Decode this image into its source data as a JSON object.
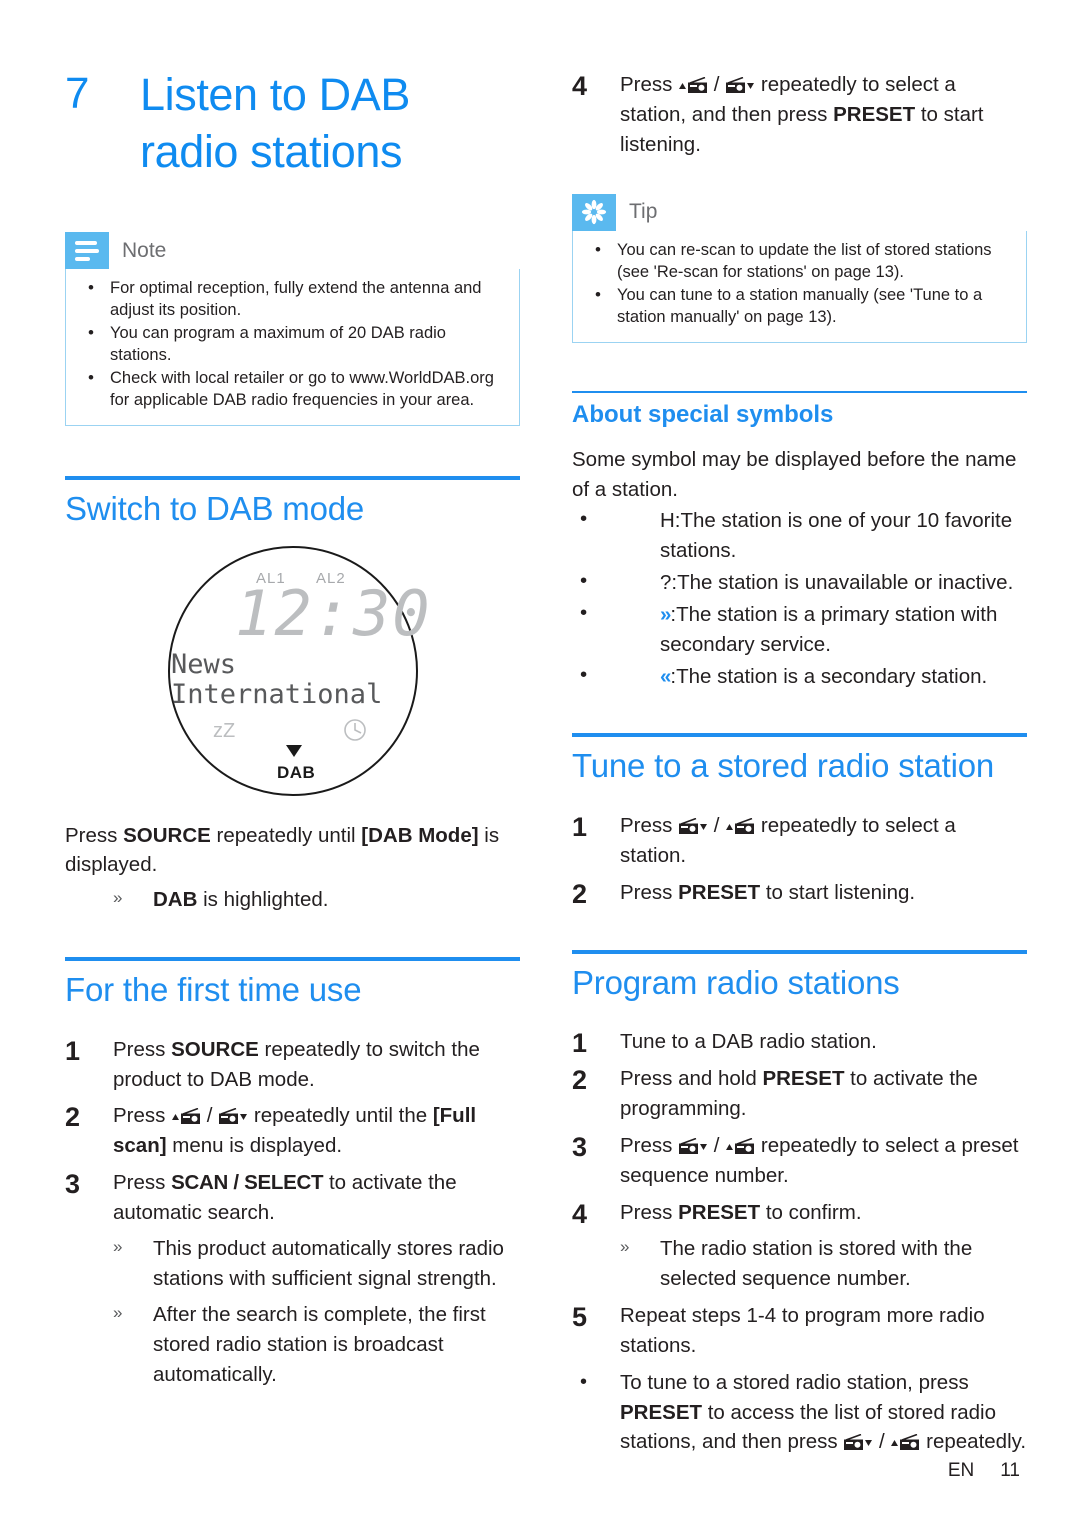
{
  "chapter": {
    "number": "7",
    "title_line1": "Listen to DAB",
    "title_line2": "radio stations"
  },
  "note": {
    "label": "Note",
    "icon": "note-lines-icon",
    "items": [
      "For optimal reception, fully extend the antenna and adjust its position.",
      "You can program a maximum of 20 DAB radio stations.",
      "Check with local retailer or go to www.WorldDAB.org for applicable DAB radio frequencies in your area."
    ]
  },
  "switch_section": {
    "heading": "Switch to DAB mode",
    "lcd": {
      "alarm1": "AL1",
      "alarm2": "AL2",
      "time": "12:30",
      "station_line1": "News",
      "station_line2": "International",
      "sleep": "zZ",
      "timer_icon": "clock-icon",
      "marker_icon": "down-triangle-icon",
      "band": "DAB"
    },
    "instruction_pre": "Press ",
    "instruction_bold": "SOURCE",
    "instruction_mid": " repeatedly until ",
    "instruction_bold2": "[DAB Mode]",
    "instruction_post": " is displayed.",
    "result_bold": "DAB",
    "result_post": " is highlighted."
  },
  "first_time_section": {
    "heading": "For the first time use",
    "steps": [
      {
        "num": "1",
        "parts": [
          {
            "t": "Press ",
            "s": "n"
          },
          {
            "t": "SOURCE",
            "s": "b"
          },
          {
            "t": " repeatedly to switch the product to DAB mode.",
            "s": "n"
          }
        ]
      },
      {
        "num": "2",
        "parts": [
          {
            "t": "Press ",
            "s": "n"
          },
          {
            "t": "",
            "s": "icon-up"
          },
          {
            "t": " / ",
            "s": "n"
          },
          {
            "t": "",
            "s": "icon-down"
          },
          {
            "t": " repeatedly until the ",
            "s": "n"
          },
          {
            "t": "[Full scan]",
            "s": "b"
          },
          {
            "t": " menu is displayed.",
            "s": "n"
          }
        ]
      },
      {
        "num": "3",
        "parts": [
          {
            "t": "Press ",
            "s": "n"
          },
          {
            "t": "SCAN / SELECT",
            "s": "c"
          },
          {
            "t": " to activate the automatic search.",
            "s": "n"
          }
        ]
      }
    ],
    "results": [
      "This product automatically stores radio stations with sufficient signal strength.",
      "After the search is complete, the first stored radio station is broadcast automatically."
    ]
  },
  "step4": {
    "num": "4",
    "parts": [
      {
        "t": "Press ",
        "s": "n"
      },
      {
        "t": "",
        "s": "icon-up"
      },
      {
        "t": " / ",
        "s": "n"
      },
      {
        "t": "",
        "s": "icon-down"
      },
      {
        "t": " repeatedly to select a station, and then press ",
        "s": "n"
      },
      {
        "t": "PRESET",
        "s": "b"
      },
      {
        "t": " to start listening.",
        "s": "n"
      }
    ]
  },
  "tip": {
    "label": "Tip",
    "icon": "asterisk-flower-icon",
    "items": [
      "You can re-scan to update the list of stored stations (see 'Re-scan for stations' on page 13).",
      "You can tune to a station manually (see 'Tune to a station manually' on page 13)."
    ]
  },
  "symbols_section": {
    "heading": "About special symbols",
    "intro": "Some symbol may be displayed before the name of a station.",
    "items": [
      {
        "sym": "H:",
        "sym_style": "plain",
        "text": "The station is one of your 10 favorite stations."
      },
      {
        "sym": "?:",
        "sym_style": "plain",
        "text": "The station is unavailable or inactive."
      },
      {
        "sym": "»",
        "sym_style": "blue",
        "text": ":The station is a primary station with secondary service."
      },
      {
        "sym": "«",
        "sym_style": "blue",
        "text": ":The station is a secondary station."
      }
    ]
  },
  "tune_section": {
    "heading": "Tune to a stored radio station",
    "steps": [
      {
        "num": "1",
        "parts": [
          {
            "t": "Press ",
            "s": "n"
          },
          {
            "t": "",
            "s": "icon-down"
          },
          {
            "t": " / ",
            "s": "n"
          },
          {
            "t": "",
            "s": "icon-up"
          },
          {
            "t": " repeatedly to select a station.",
            "s": "n"
          }
        ]
      },
      {
        "num": "2",
        "parts": [
          {
            "t": "Press ",
            "s": "n"
          },
          {
            "t": "PRESET",
            "s": "b"
          },
          {
            "t": " to start listening.",
            "s": "n"
          }
        ]
      }
    ]
  },
  "program_section": {
    "heading": "Program radio stations",
    "steps": [
      {
        "num": "1",
        "parts": [
          {
            "t": "Tune to a DAB radio station.",
            "s": "n"
          }
        ]
      },
      {
        "num": "2",
        "parts": [
          {
            "t": "Press and hold ",
            "s": "n"
          },
          {
            "t": "PRESET",
            "s": "b"
          },
          {
            "t": " to activate the programming.",
            "s": "n"
          }
        ]
      },
      {
        "num": "3",
        "parts": [
          {
            "t": "Press ",
            "s": "n"
          },
          {
            "t": "",
            "s": "icon-down"
          },
          {
            "t": " / ",
            "s": "n"
          },
          {
            "t": "",
            "s": "icon-up"
          },
          {
            "t": " repeatedly to select a preset sequence number.",
            "s": "n"
          }
        ]
      },
      {
        "num": "4",
        "parts": [
          {
            "t": "Press ",
            "s": "n"
          },
          {
            "t": "PRESET",
            "s": "b"
          },
          {
            "t": " to confirm.",
            "s": "n"
          }
        ]
      }
    ],
    "step4_result": "The radio station is stored with the selected sequence number.",
    "step5": {
      "num": "5",
      "parts": [
        {
          "t": "Repeat steps 1-4 to program more radio stations.",
          "s": "n"
        }
      ]
    },
    "final_bullet": {
      "parts": [
        {
          "t": "To tune to a stored radio station, press ",
          "s": "n"
        },
        {
          "t": "PRESET",
          "s": "b"
        },
        {
          "t": " to access the list of stored radio stations, and then press ",
          "s": "n"
        },
        {
          "t": "",
          "s": "icon-down"
        },
        {
          "t": " / ",
          "s": "n"
        },
        {
          "t": "",
          "s": "icon-up"
        },
        {
          "t": " repeatedly.",
          "s": "n"
        }
      ]
    }
  },
  "footer": {
    "language": "EN",
    "page": "11"
  },
  "colors": {
    "brand_blue": "#1f8eef",
    "callout_blue": "#5ab9ef",
    "callout_border": "#9bd3f2",
    "text": "#231f20"
  }
}
